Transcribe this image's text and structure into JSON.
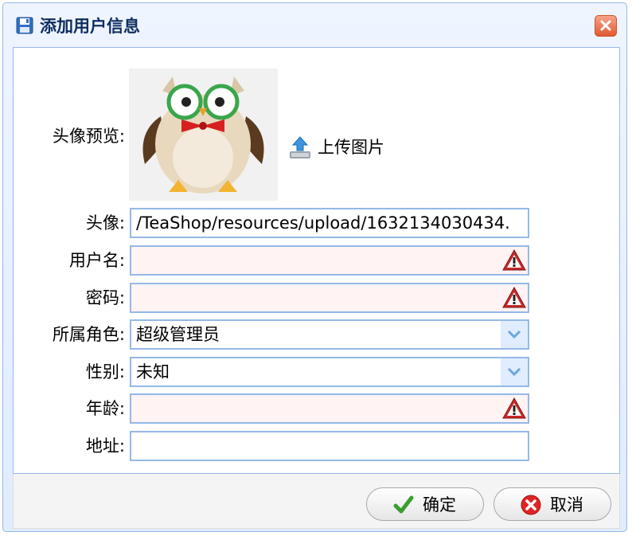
{
  "dialog": {
    "title": "添加用户信息"
  },
  "form": {
    "preview_label": "头像预览:",
    "upload_label": "上传图片",
    "avatar_label": "头像:",
    "avatar_value": "/TeaShop/resources/upload/1632134030434.",
    "username_label": "用户名:",
    "username_value": "",
    "password_label": "密码:",
    "password_value": "",
    "role_label": "所属角色:",
    "role_value": "超级管理员",
    "gender_label": "性别:",
    "gender_value": "未知",
    "age_label": "年龄:",
    "age_value": "",
    "address_label": "地址:",
    "address_value": ""
  },
  "buttons": {
    "ok": "确定",
    "cancel": "取消"
  },
  "colors": {
    "border": "#95b8e7",
    "invalid_bg": "#fff3f3",
    "title": "#0e2d5f"
  }
}
